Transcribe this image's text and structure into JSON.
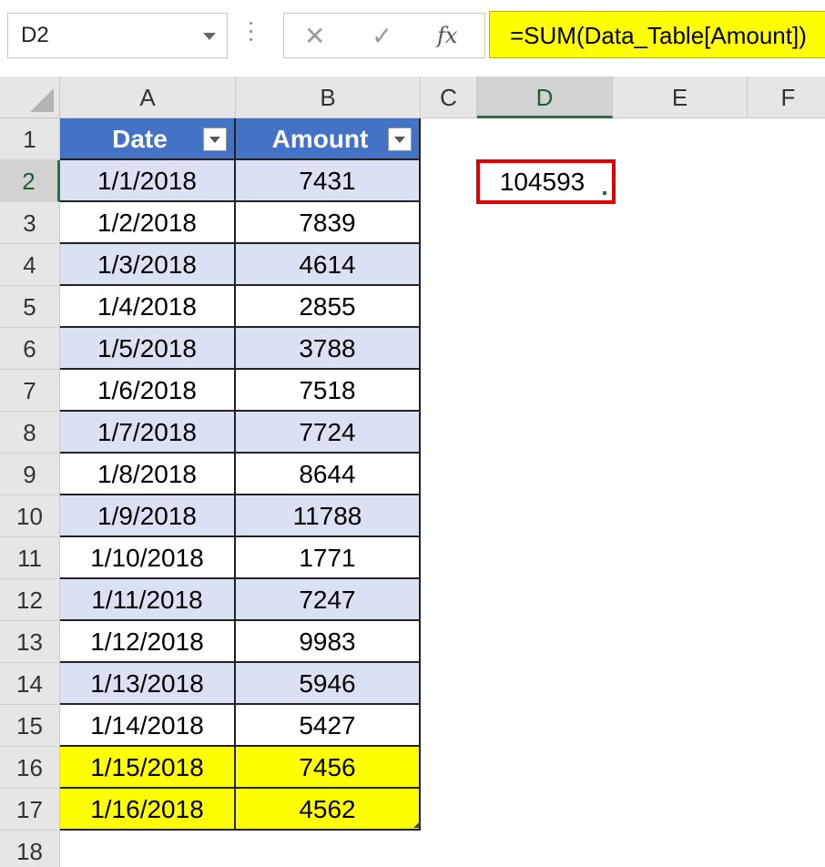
{
  "formula_bar": {
    "name_box": "D2",
    "cancel_icon": "✕",
    "enter_icon": "✓",
    "fx_label": "fx",
    "formula": "=SUM(Data_Table[Amount])"
  },
  "columns": [
    "A",
    "B",
    "C",
    "D",
    "E",
    "F"
  ],
  "active_column": "D",
  "active_row": 2,
  "table": {
    "headers": [
      "Date",
      "Amount"
    ],
    "rows": [
      {
        "row": 2,
        "date": "1/1/2018",
        "amount": "7431"
      },
      {
        "row": 3,
        "date": "1/2/2018",
        "amount": "7839"
      },
      {
        "row": 4,
        "date": "1/3/2018",
        "amount": "4614"
      },
      {
        "row": 5,
        "date": "1/4/2018",
        "amount": "2855"
      },
      {
        "row": 6,
        "date": "1/5/2018",
        "amount": "3788"
      },
      {
        "row": 7,
        "date": "1/6/2018",
        "amount": "7518"
      },
      {
        "row": 8,
        "date": "1/7/2018",
        "amount": "7724"
      },
      {
        "row": 9,
        "date": "1/8/2018",
        "amount": "8644"
      },
      {
        "row": 10,
        "date": "1/9/2018",
        "amount": "11788"
      },
      {
        "row": 11,
        "date": "1/10/2018",
        "amount": "1771"
      },
      {
        "row": 12,
        "date": "1/11/2018",
        "amount": "7247"
      },
      {
        "row": 13,
        "date": "1/12/2018",
        "amount": "9983"
      },
      {
        "row": 14,
        "date": "1/13/2018",
        "amount": "5946"
      },
      {
        "row": 15,
        "date": "1/14/2018",
        "amount": "5427"
      },
      {
        "row": 16,
        "date": "1/15/2018",
        "amount": "7456"
      },
      {
        "row": 17,
        "date": "1/16/2018",
        "amount": "4562"
      }
    ],
    "highlighted_rows": [
      16,
      17
    ]
  },
  "row_numbers": [
    "1",
    "2",
    "3",
    "4",
    "5",
    "6",
    "7",
    "8",
    "9",
    "10",
    "11",
    "12",
    "13",
    "14",
    "15",
    "16",
    "17",
    "18"
  ],
  "sum_result": "104593",
  "colors": {
    "header_fill": "#4472c4",
    "band_fill": "#d9e1f2",
    "highlight_fill": "#ffff00",
    "sum_border": "#e00000",
    "active_accent": "#217346"
  }
}
